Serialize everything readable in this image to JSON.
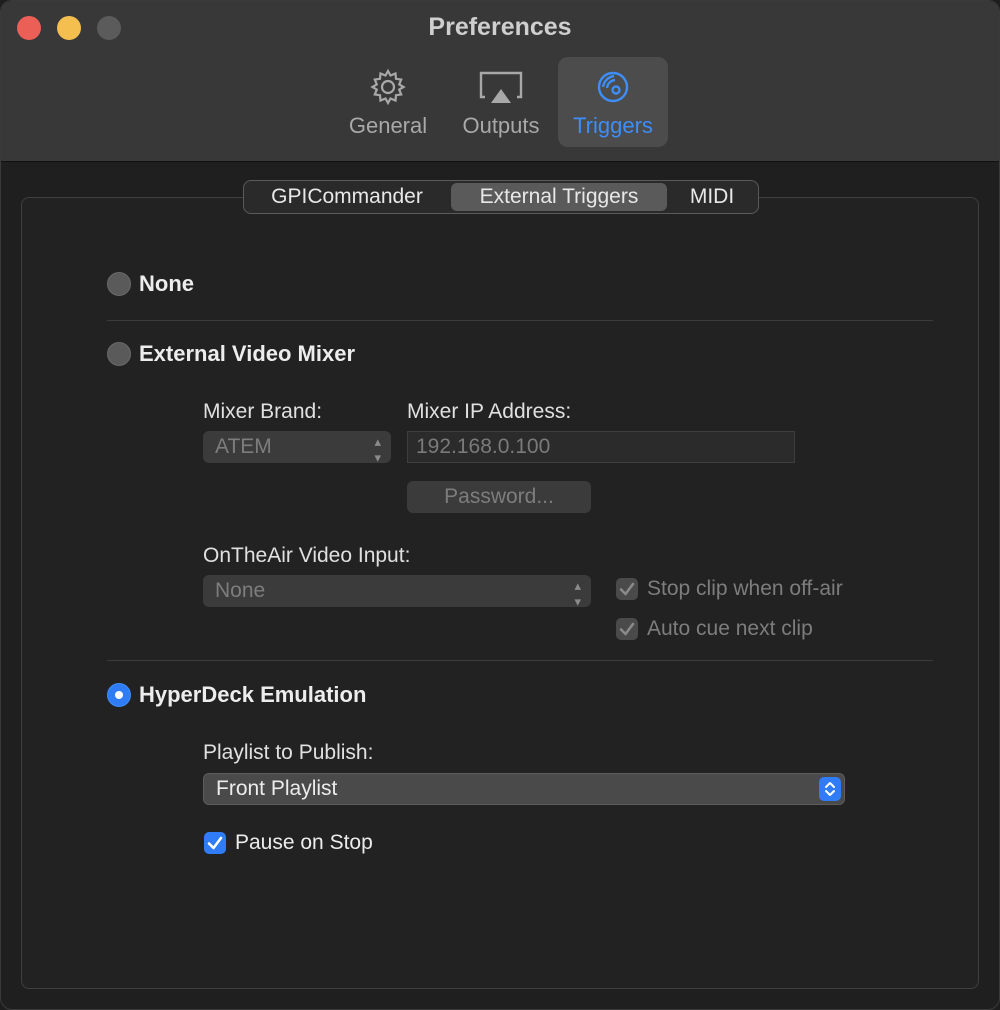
{
  "window": {
    "title": "Preferences"
  },
  "toolbar": {
    "items": [
      {
        "label": "General",
        "icon": "gear-icon"
      },
      {
        "label": "Outputs",
        "icon": "airplay-icon"
      },
      {
        "label": "Triggers",
        "icon": "triggers-icon",
        "selected": true
      }
    ]
  },
  "tabs": {
    "items": [
      "GPICommander",
      "External Triggers",
      "MIDI"
    ],
    "active": "External Triggers"
  },
  "options": {
    "none": {
      "label": "None",
      "selected": false
    },
    "mixer": {
      "label": "External Video Mixer",
      "selected": false
    },
    "hyperdeck": {
      "label": "HyperDeck Emulation",
      "selected": true
    }
  },
  "mixer": {
    "brand_label": "Mixer Brand:",
    "brand_value": "ATEM",
    "ip_label": "Mixer IP Address:",
    "ip_value": "192.168.0.100",
    "password_button": "Password...",
    "input_label": "OnTheAir Video Input:",
    "input_value": "None",
    "stop_clip_label": "Stop clip when off-air",
    "stop_clip_checked": true,
    "auto_cue_label": "Auto cue next clip",
    "auto_cue_checked": true
  },
  "hyperdeck": {
    "playlist_label": "Playlist to Publish:",
    "playlist_value": "Front Playlist",
    "pause_label": "Pause on Stop",
    "pause_checked": true
  },
  "colors": {
    "accent": "#2f7cf6",
    "selected_tab_text": "#3d8ef8"
  }
}
